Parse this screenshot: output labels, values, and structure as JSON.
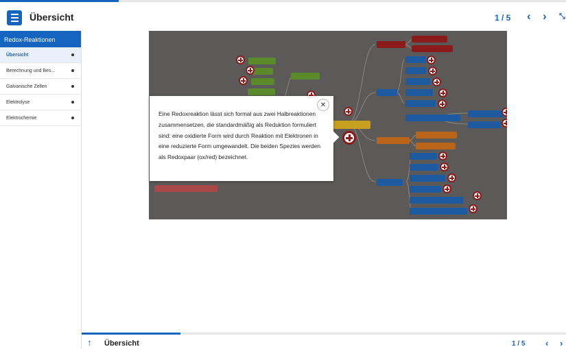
{
  "header": {
    "title": "Übersicht",
    "page_indicator": "1 / 5",
    "prev_symbol": "‹",
    "next_symbol": "›",
    "extra_symbol": "⤡"
  },
  "sidebar": {
    "heading": "Redox-Reaktionen",
    "items": [
      {
        "label": "Übersicht"
      },
      {
        "label": "Berechnung und Bes..."
      },
      {
        "label": "Galvanische Zellen"
      },
      {
        "label": "Elektrolyse"
      },
      {
        "label": "Elektrochemie"
      }
    ]
  },
  "popover": {
    "text": "Eine Redoxreaktion lässt sich formal aus zwei Halbreaktionen zusammensetzen, die standardmäßig als Reduktion formuliert sind: eine oxidierte Form wird durch Reaktion mit Elektronen in eine reduzierte Form umgewandelt. Die beiden Spezies werden als Redoxpaar (ox/red) bezeichnet.",
    "close_symbol": "✕"
  },
  "footer": {
    "title": "Übersicht",
    "page_indicator": "1 / 5",
    "up_symbol": "↑",
    "prev_symbol": "‹",
    "next_symbol": "›"
  },
  "colors": {
    "accent": "#1565c0",
    "mindmap_bg": "#5c5a58",
    "node_red": "#8b1a1a",
    "node_green": "#5a8a2a",
    "node_blue": "#1e5aa0",
    "node_orange": "#b8651a",
    "node_yellow": "#c8a020"
  }
}
